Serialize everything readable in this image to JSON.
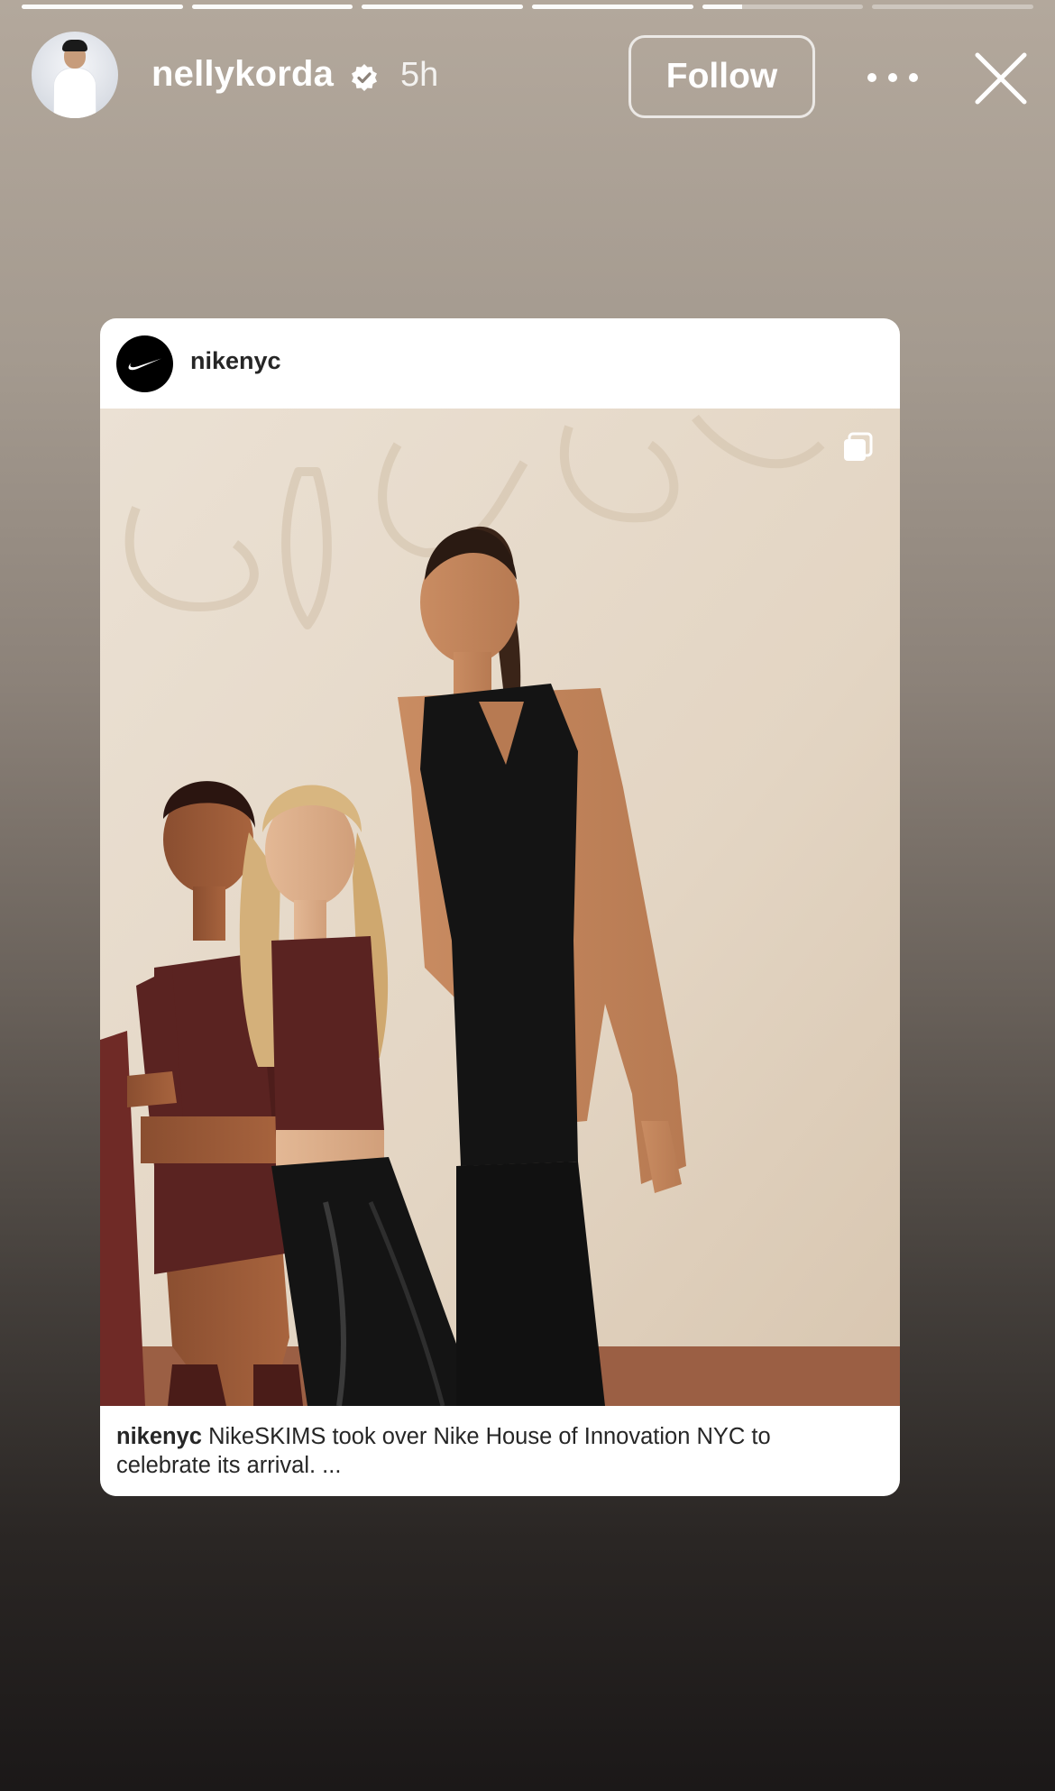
{
  "story": {
    "progress_segments": [
      1,
      1,
      1,
      1,
      0.25,
      0
    ],
    "username": "nellykorda",
    "verified": true,
    "time_ago": "5h",
    "follow_label": "Follow",
    "avatar_icon": "profile-avatar",
    "more_icon": "more-dots-icon",
    "close_icon": "close-icon"
  },
  "shared_post": {
    "username": "nikenyc",
    "avatar_icon": "nike-swoosh-logo",
    "multi_image_icon": "carousel-icon",
    "caption_user": "nikenyc",
    "caption_text": "NikeSKIMS took over Nike House of Innovation NYC to celebrate its arrival. ..."
  },
  "colors": {
    "story_top": "#b3a89c",
    "story_bottom": "#1b1818",
    "accent_white": "#ffffff",
    "outfit_brown": "#5a2321",
    "outfit_black": "#141414"
  }
}
